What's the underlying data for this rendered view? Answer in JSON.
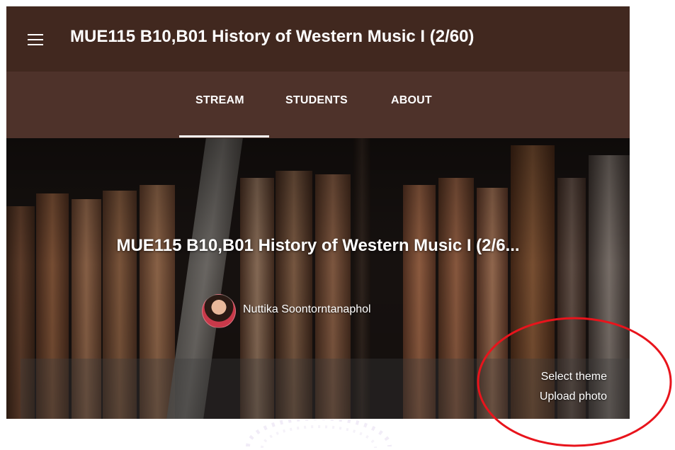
{
  "header": {
    "title": "MUE115 B10,B01 History of Western Music I (2/60)",
    "menu_icon": "hamburger-menu-icon"
  },
  "tabs": [
    {
      "label": "STREAM",
      "active": true
    },
    {
      "label": "STUDENTS",
      "active": false
    },
    {
      "label": "ABOUT",
      "active": false
    }
  ],
  "hero": {
    "class_title": "MUE115 B10,B01 History of Western Music I (2/6...",
    "teacher_name": "Nuttika Soontorntanaphol",
    "actions": {
      "select_theme": "Select theme",
      "upload_photo": "Upload photo"
    }
  },
  "colors": {
    "header_bg": "#41281f",
    "tabbar_bg": "#4e322a",
    "annotation": "#e8141c"
  }
}
